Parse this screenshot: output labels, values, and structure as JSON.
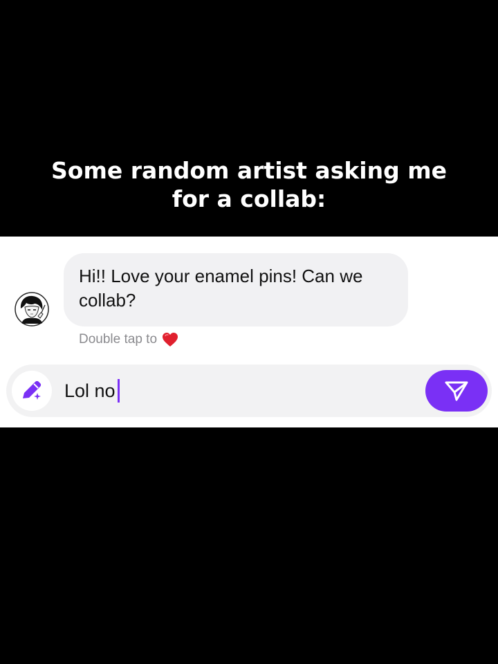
{
  "caption": {
    "line1": "Some random artist asking me",
    "line2": "for a collab:"
  },
  "chat": {
    "message": {
      "line1": "Hi!! Love your enamel pins! Can we",
      "line2": "collab?"
    },
    "hint": {
      "label": "Double tap to",
      "icon": "heart-icon"
    },
    "composer": {
      "value": "Lol no",
      "left_icon": "pencil-sparkle-icon",
      "send_icon": "send-icon"
    }
  },
  "colors": {
    "background": "#000000",
    "panel": "#ffffff",
    "bubble": "#f1f1f3",
    "accent": "#7a30f5",
    "heart": "#e0202e",
    "hint_text": "#8a8a8e"
  }
}
